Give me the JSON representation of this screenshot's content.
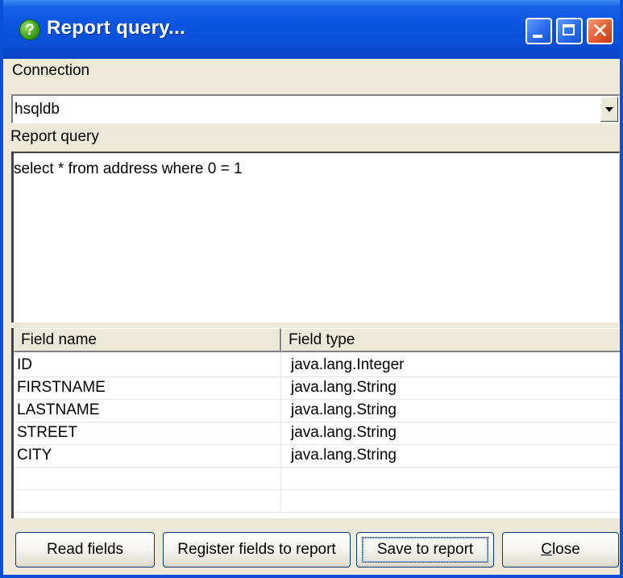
{
  "window": {
    "title": "Report query...",
    "title_icon": "help-question-icon"
  },
  "connection": {
    "label": "Connection",
    "selected": "hsqldb"
  },
  "query": {
    "label": "Report query",
    "text": "select * from address where 0 = 1"
  },
  "fields_table": {
    "columns": [
      "Field name",
      "Field type"
    ],
    "rows": [
      {
        "name": "ID",
        "type": "java.lang.Integer"
      },
      {
        "name": "FIRSTNAME",
        "type": "java.lang.String"
      },
      {
        "name": "LASTNAME",
        "type": "java.lang.String"
      },
      {
        "name": "STREET",
        "type": "java.lang.String"
      },
      {
        "name": "CITY",
        "type": "java.lang.String"
      },
      {
        "name": "",
        "type": ""
      },
      {
        "name": "",
        "type": ""
      }
    ]
  },
  "buttons": {
    "read_fields": "Read fields",
    "register_fields": "Register fields to report",
    "save_to_report": "Save to report",
    "close_first": "C",
    "close_rest": "lose"
  },
  "colors": {
    "titlebar": "#0a4fd6",
    "dialog_bg": "#ece9d8",
    "close_button": "#e2572c"
  }
}
